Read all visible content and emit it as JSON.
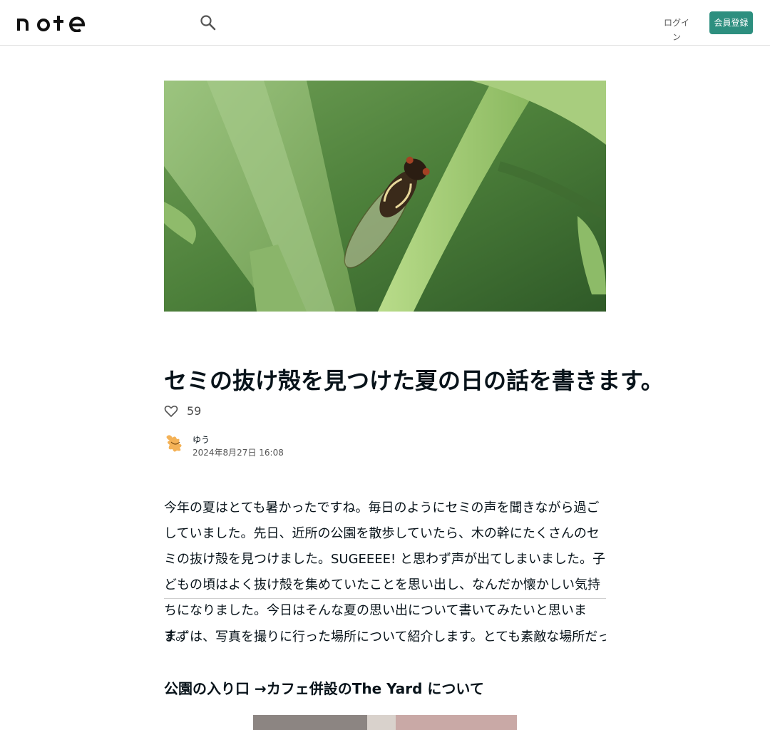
{
  "header": {
    "logo_text": "note",
    "login_label": "ログイン",
    "signup_label": "会員登録"
  },
  "article": {
    "title": "セミの抜け殻を見つけた夏の日の話を書きます。",
    "like_count": "59",
    "author_name": "ゆう",
    "date": "2024年8月27日 16:08",
    "paragraph1": "今年の夏はとても暑かったですね。毎日のようにセミの声を聞きながら過ごしていました。先日、近所の公園を散歩していたら、木の幹にたくさんのセミの抜け殻を見つけました。SUGEEEE! と思わず声が出てしまいました。子どもの頃はよく抜け殻を集めていたことを思い出し、なんだか懐かしい気持ちになりました。今日はそんな夏の思い出について書いてみたいと思います。",
    "paragraph2": "まずは、写真を撮りに行った場所について紹介します。とても素敵な場所だったので、ぜひ行ってみてください。",
    "heading2": "公園の入り口 →カフェ併設のThe Yard について"
  },
  "colors": {
    "accent": "#2d8f7f",
    "text": "#08131a"
  },
  "icons": {
    "search": "search-icon",
    "heart": "heart-icon"
  }
}
